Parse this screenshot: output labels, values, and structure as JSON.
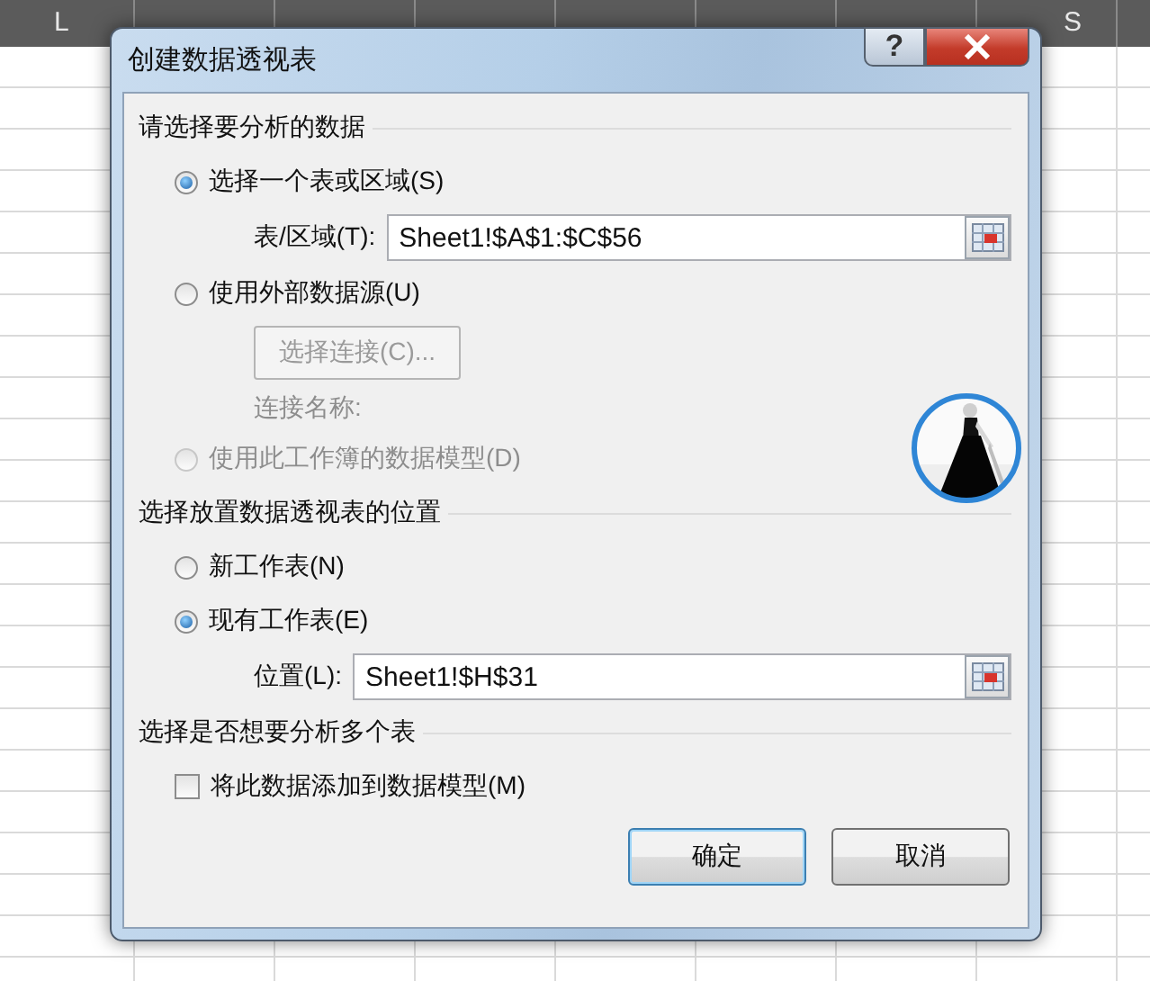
{
  "sheet": {
    "first_column": "L",
    "last_column": "S"
  },
  "dialog": {
    "title": "创建数据透视表",
    "help_button": "?",
    "sections": [
      {
        "heading": "请选择要分析的数据",
        "items": [
          {
            "kind": "radio",
            "label": "选择一个表或区域(S)",
            "selected": true,
            "disabled": false
          },
          {
            "kind": "field",
            "label": "表/区域(T):",
            "value": "Sheet1!$A$1:$C$56"
          },
          {
            "kind": "radio",
            "label": "使用外部数据源(U)",
            "selected": false,
            "disabled": false
          },
          {
            "kind": "button",
            "label": "选择连接(C)...",
            "disabled": true
          },
          {
            "kind": "text",
            "label": "连接名称:",
            "disabled": true
          },
          {
            "kind": "radio",
            "label": "使用此工作簿的数据模型(D)",
            "selected": false,
            "disabled": true
          }
        ]
      },
      {
        "heading": "选择放置数据透视表的位置",
        "items": [
          {
            "kind": "radio",
            "label": "新工作表(N)",
            "selected": false,
            "disabled": false
          },
          {
            "kind": "radio",
            "label": "现有工作表(E)",
            "selected": true,
            "disabled": false
          },
          {
            "kind": "field",
            "label": "位置(L):",
            "value": "Sheet1!$H$31"
          }
        ]
      },
      {
        "heading": "选择是否想要分析多个表",
        "items": [
          {
            "kind": "checkbox",
            "label": "将此数据添加到数据模型(M)",
            "checked": false
          }
        ]
      }
    ],
    "buttons": [
      {
        "label": "确定",
        "default": true
      },
      {
        "label": "取消",
        "default": false
      }
    ]
  }
}
